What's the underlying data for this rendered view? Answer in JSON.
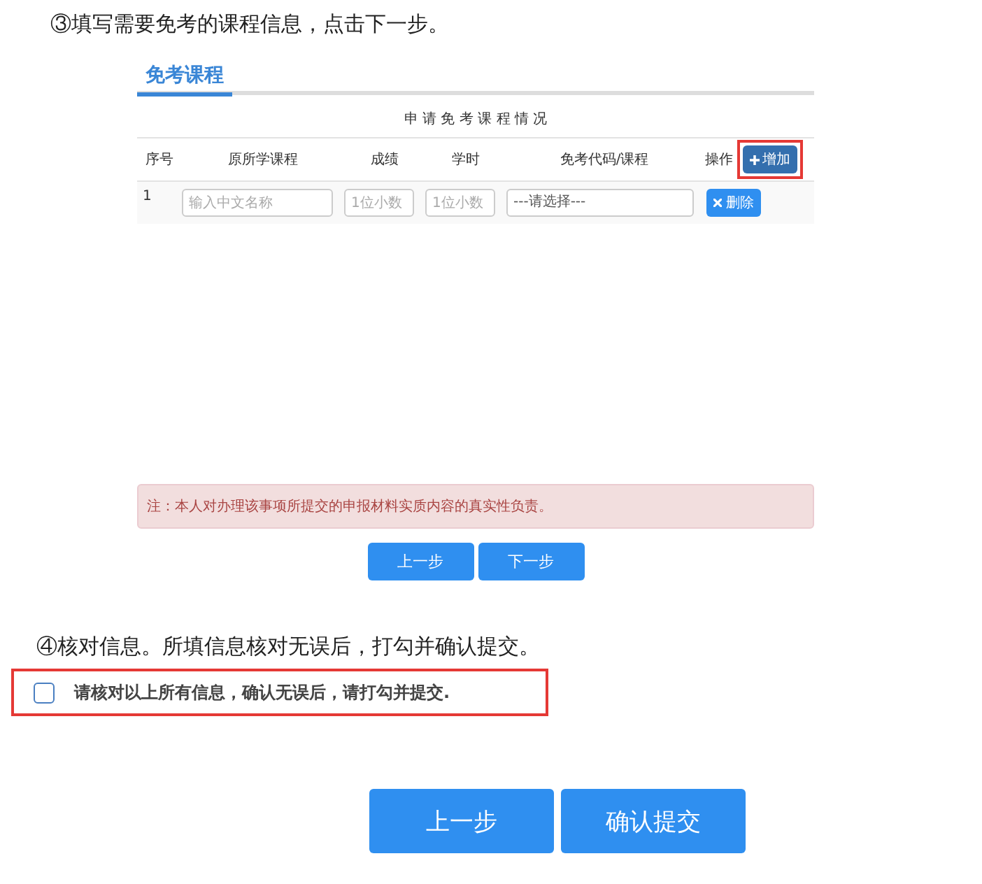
{
  "step3": {
    "instruction": "③填写需要免考的课程信息，点击下一步。",
    "section_tab": {
      "label": "免考课程",
      "selected": true
    },
    "table": {
      "title": "申 请 免 考 课 程 情 况",
      "columns": [
        "序号",
        "原所学课程",
        "成绩",
        "学时",
        "免考代码/课程",
        "操作"
      ],
      "add_button": {
        "label": "增加",
        "highlighted": true
      },
      "rows": [
        {
          "index": "1",
          "course": {
            "placeholder": "输入中文名称"
          },
          "score": {
            "placeholder": "1位小数"
          },
          "hours": {
            "placeholder": "1位小数"
          },
          "exam_course": "---请选择---",
          "delete_label": "删除"
        }
      ]
    },
    "notice": "注：本人对办理该事项所提交的申报材料实质内容的真实性负责。",
    "buttons": [
      "上一步",
      "下一步"
    ]
  },
  "step4": {
    "instruction": "④核对信息。所填信息核对无误后，打勾并确认提交。",
    "confirm": {
      "label": "请核对以上所有信息，确认无误后，请打勾并提交.",
      "checked": false,
      "highlighted": true
    },
    "buttons": [
      "上一步",
      "确认提交"
    ]
  }
}
